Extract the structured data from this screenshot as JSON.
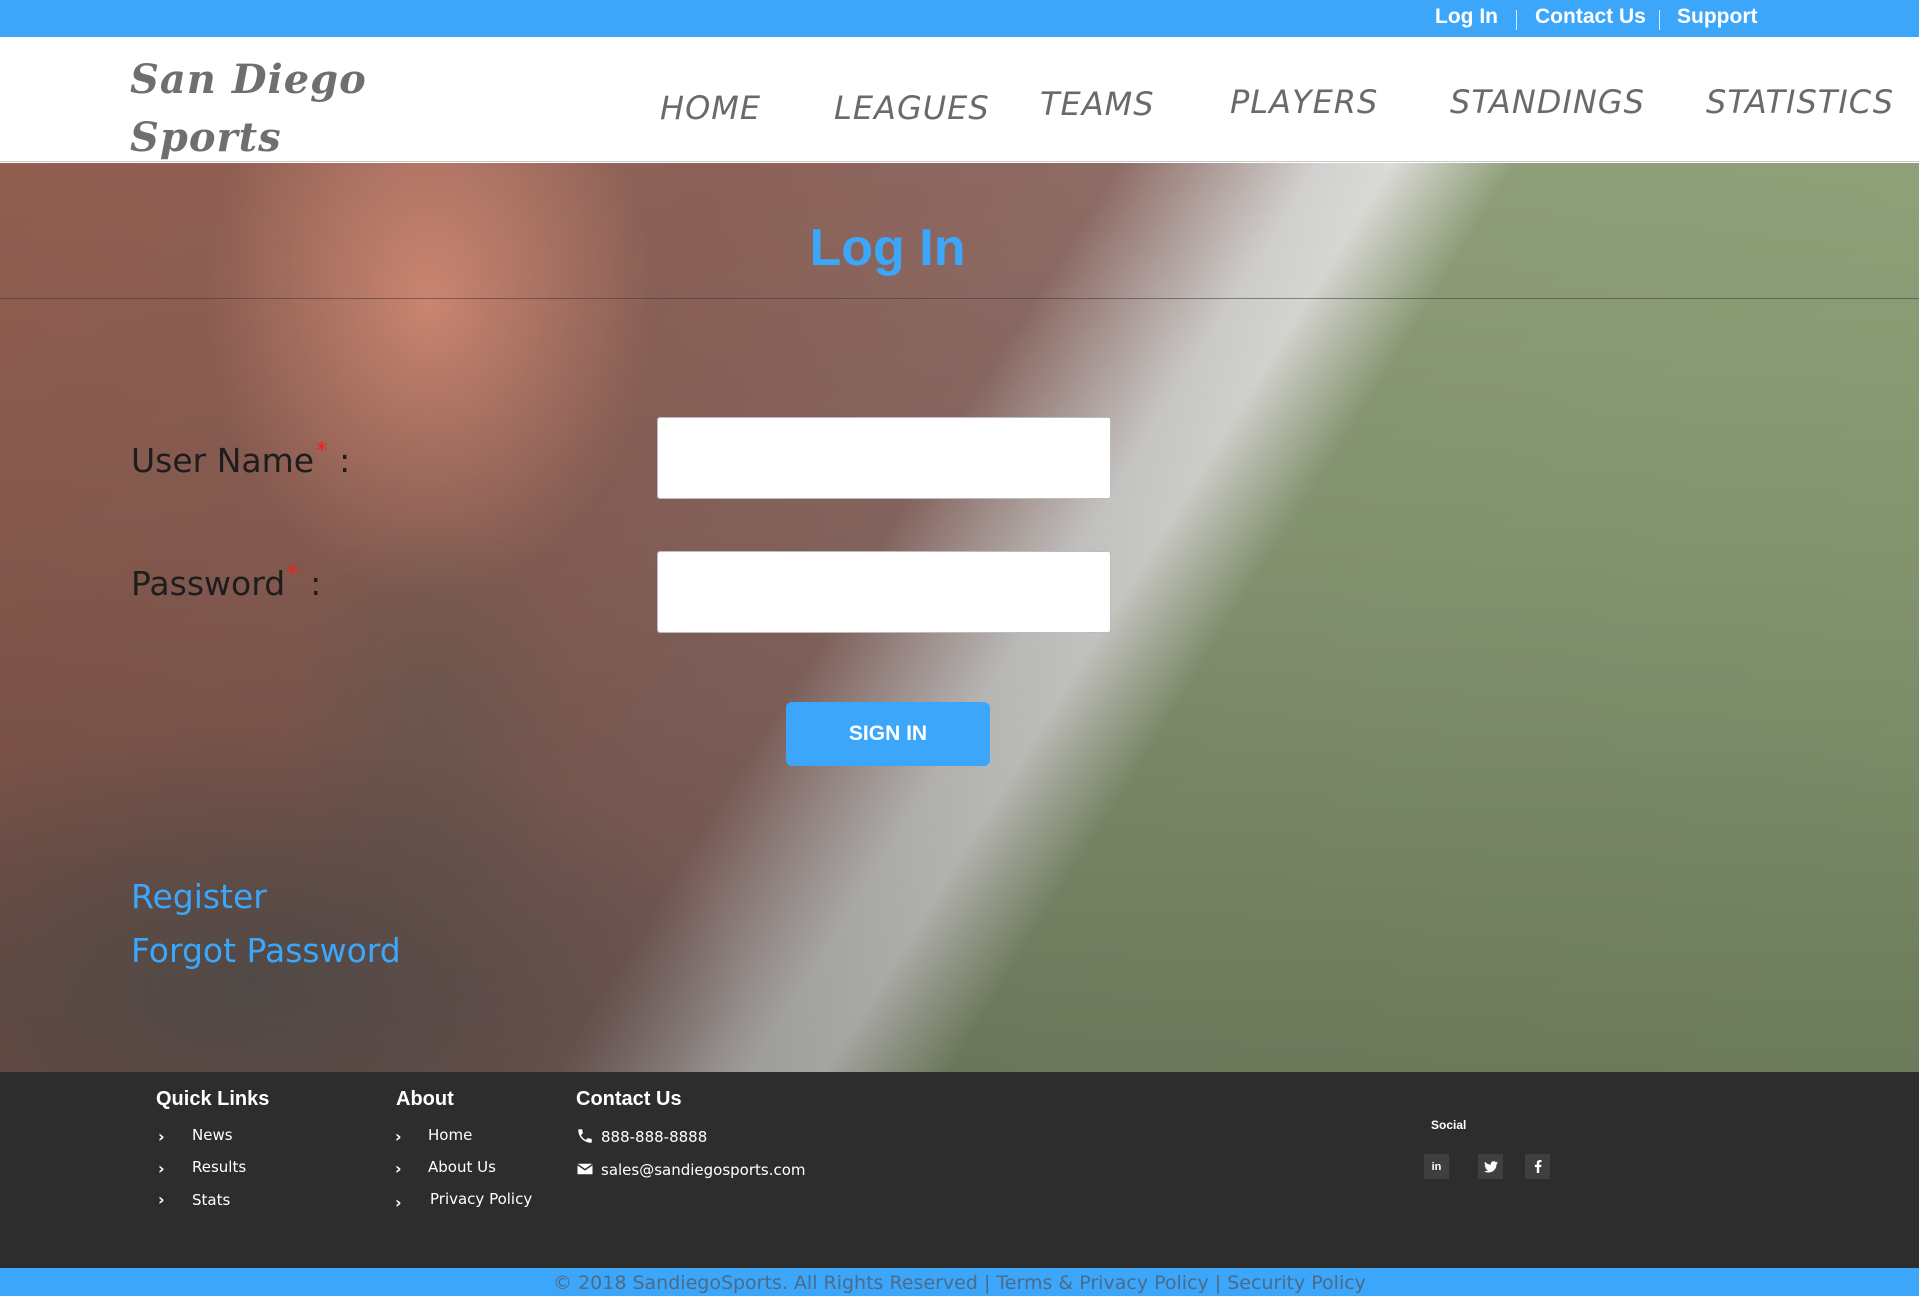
{
  "topbar": {
    "links": [
      "Log In",
      "Contact Us",
      "Support"
    ]
  },
  "header": {
    "logo_line1": "San Diego",
    "logo_line2": "Sports",
    "nav": [
      "HOME",
      "LEAGUES",
      "TEAMS",
      "PLAYERS",
      "STANDINGS",
      "STATISTICS"
    ]
  },
  "login": {
    "title": "Log In",
    "username_label": "User Name",
    "password_label": "Password",
    "required_mark": "*",
    "colon": ":",
    "username_value": "",
    "password_value": "",
    "signin_label": "SIGN IN",
    "register_link": "Register",
    "forgot_link": "Forgot Password"
  },
  "footer": {
    "quick_links": {
      "heading": "Quick Links",
      "items": [
        "News",
        "Results",
        "Stats"
      ]
    },
    "about": {
      "heading": "About",
      "items": [
        "Home",
        "About Us",
        "Privacy Policy"
      ]
    },
    "contact": {
      "heading": "Contact Us",
      "phone": "888-888-8888",
      "email": "sales@sandiegosports.com"
    },
    "social": {
      "heading": "Social",
      "buttons": [
        "in",
        "twitter-icon",
        "facebook-icon"
      ]
    },
    "copyright": "© 2018 SandiegoSports. All Rights Reserved | Terms & Privacy Policy | Security Policy"
  },
  "colors": {
    "accent": "#3ca6fb",
    "footer_bg": "#2d2d2d",
    "required": "#ff1a1a"
  }
}
